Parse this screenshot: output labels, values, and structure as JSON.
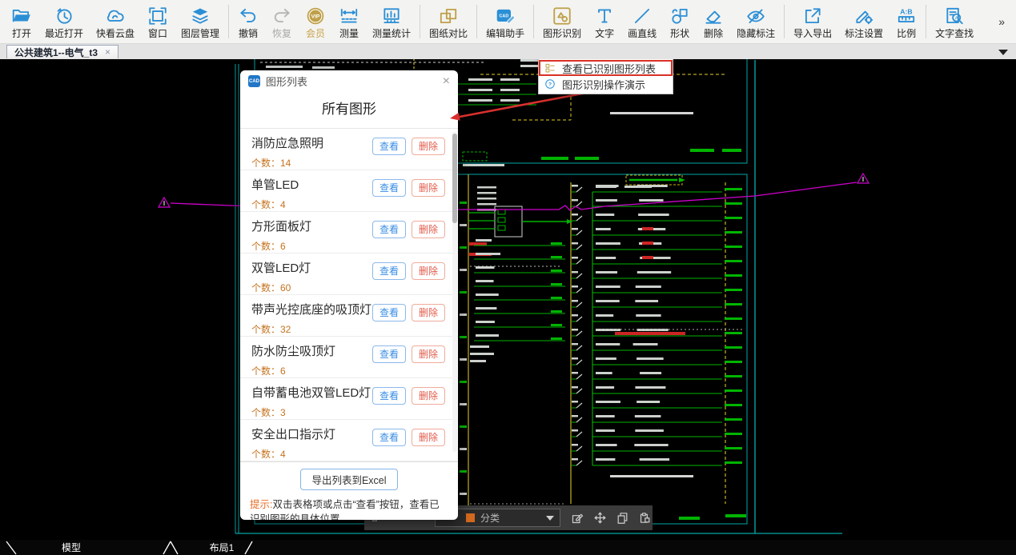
{
  "toolbar": {
    "items": [
      {
        "label": "打开",
        "icon": "open-folder",
        "tone": "blue"
      },
      {
        "label": "最近打开",
        "icon": "recent-clock",
        "tone": "blue"
      },
      {
        "label": "快看云盘",
        "icon": "cloud",
        "tone": "blue"
      },
      {
        "label": "窗口",
        "icon": "window",
        "tone": "blue"
      },
      {
        "label": "图层管理",
        "icon": "layers",
        "tone": "blue",
        "sep_after": true
      },
      {
        "label": "撤销",
        "icon": "undo",
        "tone": "blue"
      },
      {
        "label": "恢复",
        "icon": "redo",
        "tone": "disabled"
      },
      {
        "label": "会员",
        "icon": "vip",
        "tone": "gold",
        "gold_label": true
      },
      {
        "label": "测量",
        "icon": "ruler",
        "tone": "blue"
      },
      {
        "label": "测量统计",
        "icon": "measure-stats",
        "tone": "blue",
        "sep_after": true
      },
      {
        "label": "图纸对比",
        "icon": "compare",
        "tone": "gold",
        "sep_after": true
      },
      {
        "label": "编辑助手",
        "icon": "edit-assistant",
        "tone": "blue",
        "sep_after": true
      },
      {
        "label": "图形识别",
        "icon": "shape-recognition",
        "tone": "gold"
      },
      {
        "label": "文字",
        "icon": "text",
        "tone": "blue"
      },
      {
        "label": "画直线",
        "icon": "line",
        "tone": "blue"
      },
      {
        "label": "形状",
        "icon": "shapes",
        "tone": "blue"
      },
      {
        "label": "删除",
        "icon": "eraser",
        "tone": "blue"
      },
      {
        "label": "隐藏标注",
        "icon": "eye-off",
        "tone": "blue",
        "sep_after": true
      },
      {
        "label": "导入导出",
        "icon": "import-export",
        "tone": "blue"
      },
      {
        "label": "标注设置",
        "icon": "annotation-settings",
        "tone": "blue"
      },
      {
        "label": "比例",
        "icon": "scale",
        "tone": "blue",
        "sep_after": true
      },
      {
        "label": "文字查找",
        "icon": "text-search",
        "tone": "blue"
      }
    ],
    "overflow_indicator": "»"
  },
  "tabbar": {
    "tabs": [
      {
        "label": "公共建筑1--电气_t3",
        "close_label": "×"
      }
    ]
  },
  "menu": {
    "items": [
      {
        "label": "图形识别",
        "icon": "menu-shapes"
      },
      {
        "label": "查看已识别图形列表",
        "icon": "menu-list",
        "highlighted": true
      },
      {
        "label": "图形识别操作演示",
        "icon": "help",
        "blue": true
      }
    ]
  },
  "dialog": {
    "logo_text": "CAD",
    "title": "图形列表",
    "close_label": "×",
    "header": "所有图形",
    "count_prefix": "个数：",
    "view_label": "查看",
    "delete_label": "删除",
    "items": [
      {
        "name": "消防应急照明",
        "count": "14"
      },
      {
        "name": "单管LED",
        "count": "4"
      },
      {
        "name": "方形面板灯",
        "count": "6"
      },
      {
        "name": "双管LED灯",
        "count": "60"
      },
      {
        "name": "带声光控底座的吸顶灯",
        "count": "32"
      },
      {
        "name": "防水防尘吸顶灯",
        "count": "6"
      },
      {
        "name": "自带蓄电池双管LED灯",
        "count": "3"
      },
      {
        "name": "安全出口指示灯",
        "count": "4"
      }
    ],
    "export_label": "导出列表到Excel",
    "hint_prefix": "提示:",
    "hint_text": "双击表格项或点击“查看”按钮，查看已识别图形的具体位置"
  },
  "canvas": {
    "classify_label": "分类"
  },
  "statusbar": {
    "tabs": [
      "模型",
      "布局1"
    ]
  },
  "colors": {
    "accent_blue": "#2b8fd6",
    "gold": "#bfa04a",
    "highlight_red": "#d93025",
    "cad_green": "#00b400",
    "cad_cyan": "#00a6a6",
    "cad_yellow": "#b7a61f",
    "cad_magenta": "#cf00cf",
    "cad_red": "#cc2525"
  }
}
